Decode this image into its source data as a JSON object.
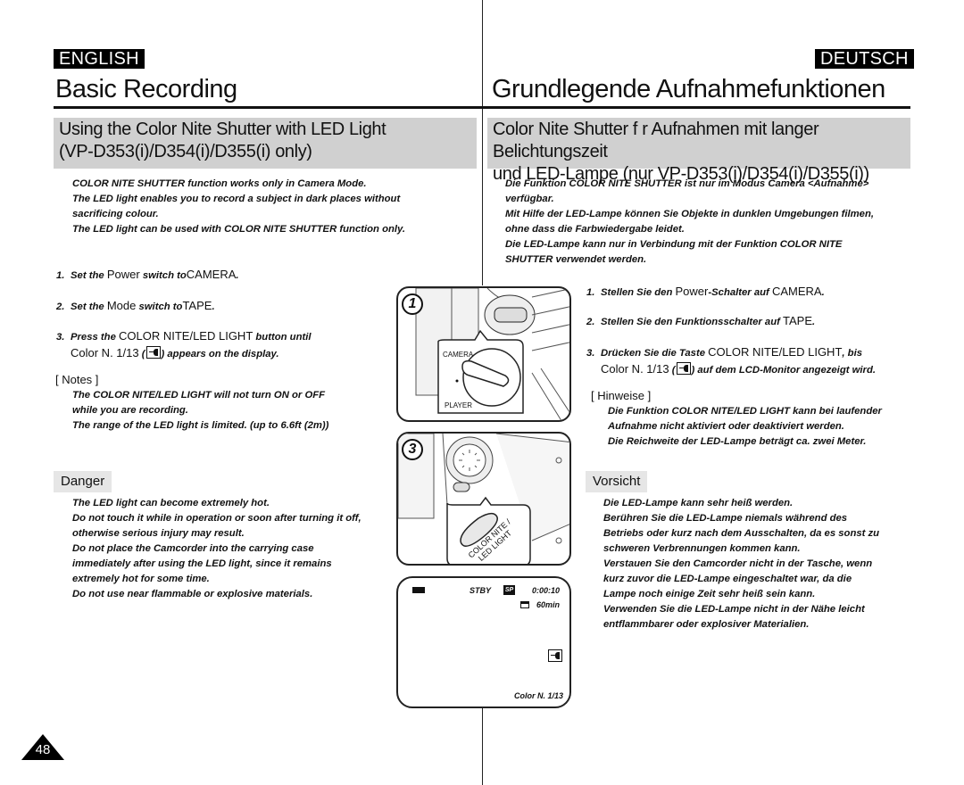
{
  "page_number": "48",
  "english": {
    "lang_tag": "ENGLISH",
    "title": "Basic Recording",
    "section_title_line1": "Using the Color Nite Shutter with LED Light",
    "section_title_line2": "(VP-D353(i)/D354(i)/D355(i) only)",
    "intro": [
      "COLOR NITE SHUTTER function works only in Camera Mode.",
      "The LED light enables you to record a subject in dark places without",
      "sacrificing colour.",
      "The LED light can be used with COLOR NITE SHUTTER function only."
    ],
    "steps": [
      {
        "num": "1.",
        "pre": "Set the",
        "key": "Power",
        "mid": "switch to",
        "val": "CAMERA",
        "end": "."
      },
      {
        "num": "2.",
        "pre": "Set the",
        "key": "Mode",
        "mid": "switch to",
        "val": "TAPE",
        "end": "."
      },
      {
        "num": "3.",
        "pre": "Press the",
        "key": "COLOR NITE/LED LIGHT",
        "mid": "button until",
        "line2_val": "Color N. 1/13",
        "line2_open": "(",
        "line2_close": ") appears on the display."
      }
    ],
    "notes_label": "[ Notes ]",
    "notes": [
      "The COLOR NITE/LED LIGHT will not turn ON or OFF",
      "while you are recording.",
      "The range of the LED light is limited. (up to 6.6ft (2m))"
    ],
    "danger_label": "Danger",
    "danger": [
      "The LED light can become extremely hot.",
      "Do not touch it while in operation or soon after turning it off,",
      "otherwise serious injury may result.",
      "Do not place the Camcorder into the carrying case",
      "immediately after using the LED light, since it remains",
      "extremely hot for some time.",
      "Do not use near flammable or explosive materials."
    ]
  },
  "deutsch": {
    "lang_tag": "DEUTSCH",
    "title": "Grundlegende Aufnahmefunktionen",
    "section_title_line1": "Color Nite Shutter f r Aufnahmen mit langer Belichtungszeit",
    "section_title_line2": "und LED-Lampe (nur VP-D353(i)/D354(i)/D355(i))",
    "intro": [
      "Die Funktion COLOR NITE SHUTTER ist nur im Modus Camera <Aufnahme>",
      "verfügbar.",
      "Mit Hilfe der LED-Lampe können Sie Objekte in dunklen Umgebungen filmen,",
      "ohne dass die Farbwiedergabe leidet.",
      "Die LED-Lampe kann nur in Verbindung mit der Funktion COLOR NITE",
      "SHUTTER verwendet werden."
    ],
    "steps": [
      {
        "num": "1.",
        "pre": "Stellen Sie den",
        "key": "Power",
        "mid": "-Schalter auf",
        "val": "CAMERA",
        "end": "."
      },
      {
        "num": "2.",
        "pre": "Stellen Sie den Funktionsschalter auf",
        "val": "TAPE",
        "end": "."
      },
      {
        "num": "3.",
        "pre": "Drücken Sie die Taste",
        "key": "COLOR NITE/LED LIGHT",
        "mid": ", bis",
        "line2_val": "Color N. 1/13",
        "line2_open": "(",
        "line2_close": ") auf dem LCD-Monitor angezeigt wird."
      }
    ],
    "notes_label": "[ Hinweise ]",
    "notes": [
      "Die Funktion COLOR NITE/LED LIGHT kann bei laufender",
      "Aufnahme nicht aktiviert oder deaktiviert werden.",
      "Die Reichweite der LED-Lampe beträgt ca. zwei Meter."
    ],
    "danger_label": "Vorsicht",
    "danger": [
      "Die LED-Lampe kann sehr heiß werden.",
      "Berühren Sie die LED-Lampe niemals während des",
      "Betriebs oder kurz nach dem Ausschalten, da es sonst zu",
      "schweren Verbrennungen kommen kann.",
      "Verstauen Sie den Camcorder nicht in der Tasche, wenn",
      "kurz zuvor die LED-Lampe eingeschaltet war, da die",
      "Lampe noch einige Zeit sehr heiß sein kann.",
      "Verwenden Sie die LED-Lampe nicht in der Nähe leicht",
      "entflammbarer oder explosiver Materialien."
    ]
  },
  "figures": {
    "fig1": {
      "number": "1",
      "label_top": "CAMERA",
      "label_bottom": "PLAYER"
    },
    "fig3": {
      "number": "3",
      "button_label_line1": "COLOR NITE /",
      "button_label_line2": "LED LIGHT"
    },
    "lcd": {
      "status": "STBY",
      "mode": "SP",
      "timecode": "0:00:10",
      "tape_remaining": "60min",
      "color_nite": "Color N. 1/13"
    }
  }
}
